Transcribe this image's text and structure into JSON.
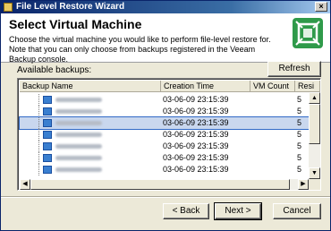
{
  "window": {
    "title": "File Level Restore Wizard",
    "close_glyph": "×"
  },
  "header": {
    "title": "Select Virtual Machine",
    "description": "Choose the virtual machine you would like to perform file-level restore for. Note that you can only choose from backups registered in the Veeam Backup console.",
    "logo_icon": "veeam-logo-icon",
    "logo_color": "#2f9a4a"
  },
  "backups": {
    "label": "Available backups:",
    "refresh_label": "Refresh",
    "columns": [
      "Backup Name",
      "Creation Time",
      "VM Count",
      "Resi"
    ],
    "rows": [
      {
        "time": "03-06-09 23:15:39",
        "vm_count": "5",
        "selected": false
      },
      {
        "time": "03-06-09 23:15:39",
        "vm_count": "5",
        "selected": false
      },
      {
        "time": "03-06-09 23:15:39",
        "vm_count": "5",
        "selected": true
      },
      {
        "time": "03-06-09 23:15:39",
        "vm_count": "5",
        "selected": false
      },
      {
        "time": "03-06-09 23:15:39",
        "vm_count": "5",
        "selected": false
      },
      {
        "time": "03-06-09 23:15:39",
        "vm_count": "5",
        "selected": false
      },
      {
        "time": "03-06-09 23:15:39",
        "vm_count": "5",
        "selected": false
      }
    ],
    "row_icon": "vm-icon",
    "selection_color": "#c9d7ee"
  },
  "footer": {
    "back_label": "< Back",
    "next_label": "Next >",
    "cancel_label": "Cancel"
  }
}
